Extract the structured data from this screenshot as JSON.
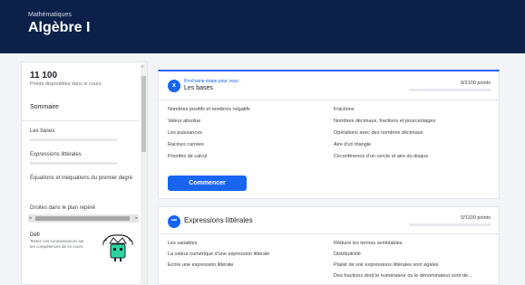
{
  "header": {
    "subject": "Mathématiques",
    "title": "Algèbre I",
    "background": "#0b2149"
  },
  "sidebar": {
    "points_value": "11 100",
    "points_label": "Points disponibles dans le cours",
    "summary_label": "Sommaire",
    "items": [
      {
        "label": "Les bases"
      },
      {
        "label": "Expressions littérales"
      },
      {
        "label": "Équations et inéquations du premier degré"
      },
      {
        "label": "Droites dans le plan repéré"
      }
    ],
    "challenge": {
      "title": "Défi",
      "text": "Testez vos connaissances sur les compétences de ce cours."
    }
  },
  "units": [
    {
      "icon": "x-icon",
      "icon_glyph": "x",
      "next_step_label": "Prochaine étape pour vous :",
      "title": "Les bases",
      "points": "0/3100 points",
      "lessons": [
        "Nombres positifs et nombres négatifs",
        "Fractions",
        "Valeur absolue",
        "Nombres décimaux, fractions et pourcentages",
        "Les puissances",
        "Opérations avec des nombres décimaux",
        "Racines carrées",
        "Aire d'un triangle",
        "Priorités de calcul",
        "Circonférence d'un cercle et aire du disque"
      ],
      "button_label": "Commencer"
    },
    {
      "icon": "dots-icon",
      "icon_glyph": "•••",
      "title": "Expressions littérales",
      "points": "0/1100 points",
      "lessons": [
        "Les variables",
        "Réduire les termes semblables",
        "La valeur numérique d'une expression littérale",
        "Distributivité",
        "Écrire une expression littérale",
        "Plaisir de voir expressions littérales sont égales",
        "",
        "Des fractions dont le numérateur ou le dénominateur sont de..."
      ]
    }
  ],
  "colors": {
    "accent": "#1865f2",
    "page_background": "#f3f4f7"
  }
}
